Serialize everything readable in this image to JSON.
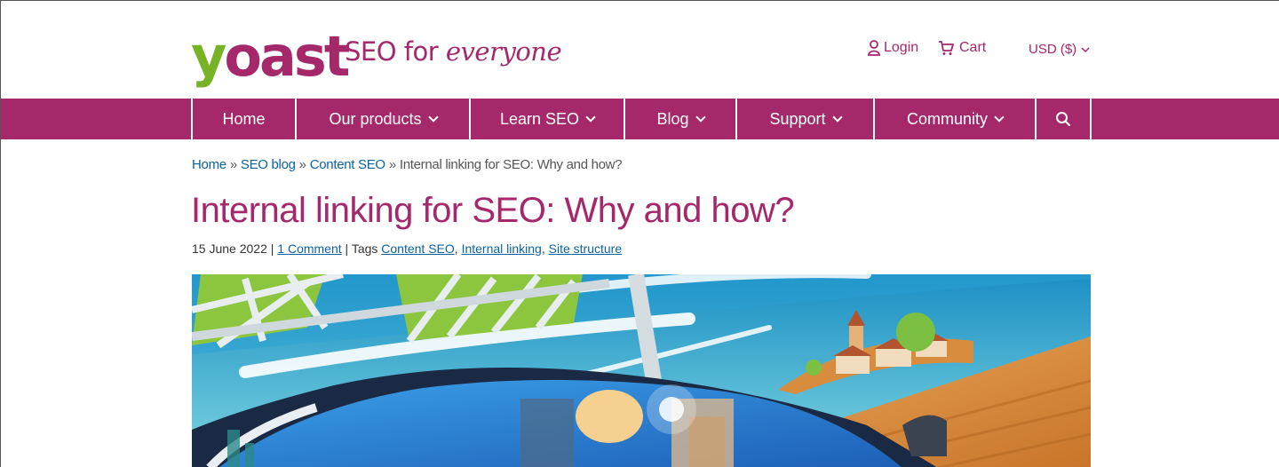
{
  "brand": {
    "logo_text": "yoast",
    "tagline_plain": "SEO for ",
    "tagline_em": "everyone",
    "colors": {
      "primary": "#a4286a",
      "green": "#77b227",
      "link": "#0b62a0"
    }
  },
  "utility": {
    "login": {
      "icon": "user-icon",
      "label": "Login"
    },
    "cart": {
      "icon": "cart-icon",
      "label": "Cart"
    },
    "currency": {
      "label": "USD ($)",
      "icon": "chevron-down-icon"
    }
  },
  "nav": {
    "items": [
      {
        "label": "Home",
        "has_dropdown": false
      },
      {
        "label": "Our products",
        "has_dropdown": true
      },
      {
        "label": "Learn SEO",
        "has_dropdown": true
      },
      {
        "label": "Blog",
        "has_dropdown": true
      },
      {
        "label": "Support",
        "has_dropdown": true
      },
      {
        "label": "Community",
        "has_dropdown": true
      }
    ],
    "search_icon": "search-icon"
  },
  "breadcrumb": {
    "items": [
      {
        "label": "Home"
      },
      {
        "label": "SEO blog"
      },
      {
        "label": "Content SEO"
      }
    ],
    "separator": "»",
    "current": "Internal linking for SEO: Why and how?"
  },
  "article": {
    "title": "Internal linking for SEO: Why and how?",
    "date": "15 June 2022",
    "comments": "1 Comment",
    "tags_label": "Tags",
    "tags": [
      "Content SEO",
      "Internal linking",
      "Site structure"
    ],
    "hero_image": "illustration of a car driving on a road under a green bridge toward a hilltop village"
  }
}
